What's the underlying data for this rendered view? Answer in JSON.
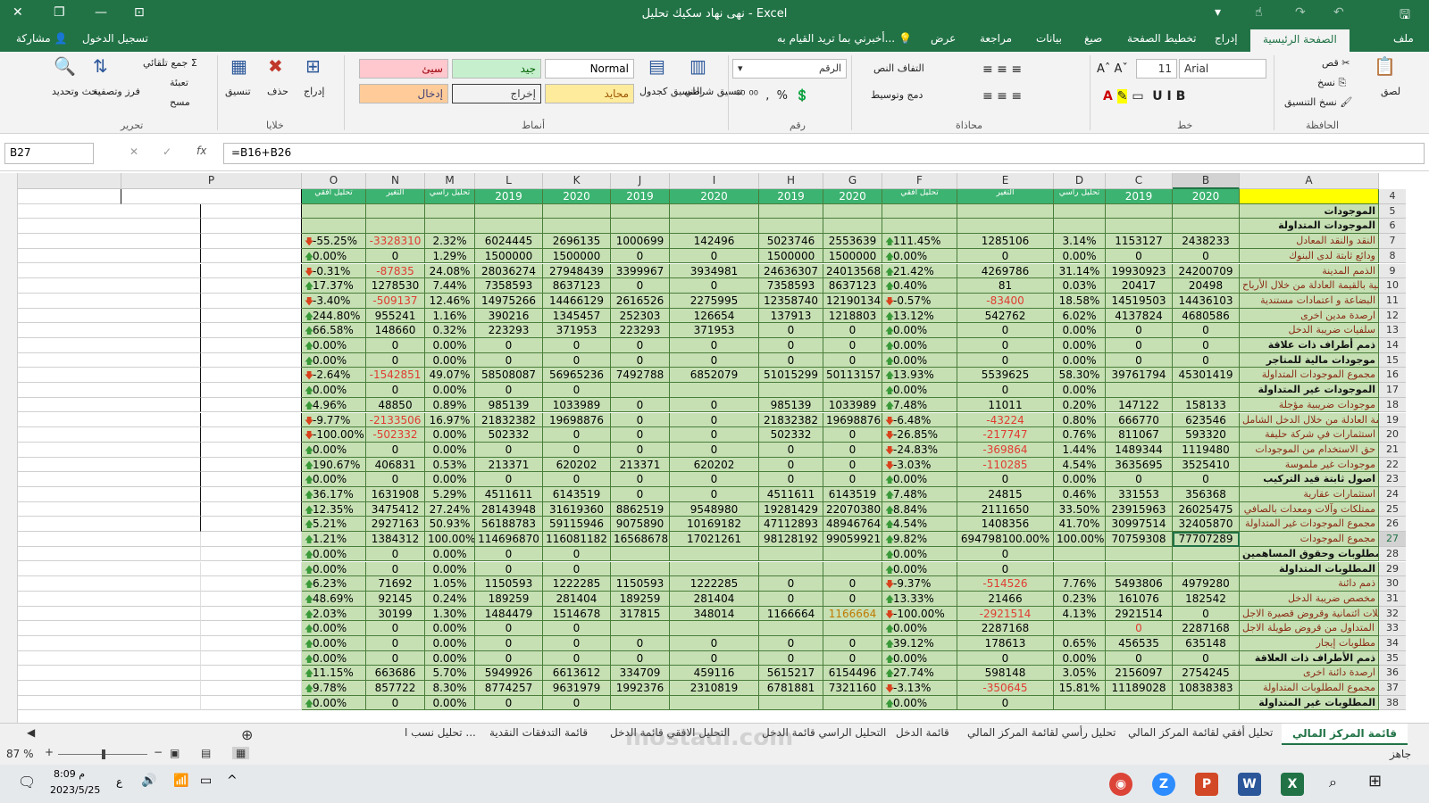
{
  "window": {
    "title": "نهى نهاد سكيك تحليل - Excel"
  },
  "ribbon_tabs": [
    "ملف",
    "الصفحة الرئيسية",
    "إدراج",
    "تخطيط الصفحة",
    "صيغ",
    "بيانات",
    "مراجعة",
    "عرض",
    "أخبرني بما تريد القيام به..."
  ],
  "share": "مشاركة",
  "signin": "تسجيل الدخول",
  "ribbon": {
    "paste": "لصق",
    "cut": "قص",
    "copy": "نسخ",
    "format_painter": "نسخ التنسيق",
    "clipboard": "الحافظة",
    "font_name": "Arial",
    "font_size": "11",
    "font_group": "خط",
    "wrap": "التفاف النص",
    "merge": "دمج وتوسيط",
    "align_group": "محاذاة",
    "number_format": "الرقم",
    "number_group": "رقم",
    "cond_format": "تنسيق شرطي",
    "format_table": "التنسيق كجدول",
    "styles_group": "أنماط",
    "style_normal": "Normal",
    "style_good": "جيد",
    "style_bad": "سيئ",
    "style_neutral": "محايد",
    "style_output": "إخراج",
    "style_input": "إدخال",
    "insert": "إدراج",
    "delete": "حذف",
    "format": "تنسيق",
    "cells_group": "خلايا",
    "autosum": "جمع تلقائي",
    "fill": "تعبئة",
    "clear": "مسح",
    "sort": "فرز وتصفية",
    "find": "بحث وتحديد",
    "edit_group": "تحرير"
  },
  "formula_bar": {
    "name_box": "B27",
    "formula": "=B16+B26"
  },
  "columns": [
    "A",
    "B",
    "C",
    "D",
    "E",
    "F",
    "G",
    "H",
    "I",
    "J",
    "K",
    "L",
    "M",
    "N",
    "O",
    "P"
  ],
  "header_row": {
    "row": "4",
    "B": "2020",
    "C": "2019",
    "D": "تحليل رأسي",
    "E": "التغير",
    "F": "تحليل أفقي",
    "G": "2020",
    "H": "2019",
    "I": "2020",
    "J": "2019",
    "K": "2020",
    "L": "2019",
    "M": "تحليل رأسي",
    "N": "التغير",
    "O": "تحليل أفقي"
  },
  "rows": [
    {
      "r": "5",
      "A": "الموجودات",
      "k": 1,
      "B": "",
      "C": "",
      "D": "",
      "E": "",
      "F": "",
      "Fa": "",
      "G": "",
      "H": "",
      "I": "",
      "J": "",
      "K": "",
      "L": "",
      "M": "",
      "N": "",
      "O": "",
      "Oa": ""
    },
    {
      "r": "6",
      "A": "الموجودات المتداولة",
      "k": 1,
      "B": "",
      "C": "",
      "D": "",
      "E": "",
      "F": "",
      "Fa": "",
      "G": "",
      "H": "",
      "I": "",
      "J": "",
      "K": "",
      "L": "",
      "M": "",
      "N": "",
      "O": "",
      "Oa": ""
    },
    {
      "r": "7",
      "A": "النقد والنقد المعادل",
      "B": "2438233",
      "C": "1153127",
      "D": "3.14%",
      "E": "1285106",
      "F": "111.45%",
      "Fa": "u",
      "G": "2553639",
      "H": "5023746",
      "I": "142496",
      "J": "1000699",
      "K": "2696135",
      "L": "6024445",
      "M": "2.32%",
      "N": "-3328310",
      "O": "-55.25%",
      "Oa": "d"
    },
    {
      "r": "8",
      "A": "ودائع ثابتة لدى البنوك",
      "B": "0",
      "C": "0",
      "D": "0.00%",
      "E": "0",
      "F": "0.00%",
      "Fa": "u",
      "G": "1500000",
      "H": "1500000",
      "I": "0",
      "J": "0",
      "K": "1500000",
      "L": "1500000",
      "M": "1.29%",
      "N": "0",
      "O": "0.00%",
      "Oa": "u"
    },
    {
      "r": "9",
      "A": "الذمم المدينة",
      "B": "24200709",
      "C": "19930923",
      "D": "31.14%",
      "E": "4269786",
      "F": "21.42%",
      "Fa": "u",
      "G": "24013568",
      "H": "24636307",
      "I": "3934981",
      "J": "3399967",
      "K": "27948439",
      "L": "28036274",
      "M": "24.08%",
      "N": "-87835",
      "O": "-0.31%",
      "Oa": "d"
    },
    {
      "r": "10",
      "A": "موجودات مالية بالقيمة العادلة من خلال الأرباح",
      "B": "20498",
      "C": "20417",
      "D": "0.03%",
      "E": "81",
      "F": "0.40%",
      "Fa": "u",
      "G": "8637123",
      "H": "7358593",
      "I": "0",
      "J": "0",
      "K": "8637123",
      "L": "7358593",
      "M": "7.44%",
      "N": "1278530",
      "O": "17.37%",
      "Oa": "u"
    },
    {
      "r": "11",
      "A": "البضاعة و اعتمادات مستندية",
      "B": "14436103",
      "C": "14519503",
      "D": "18.58%",
      "E": "-83400",
      "F": "-0.57%",
      "Fa": "d",
      "G": "12190134",
      "H": "12358740",
      "I": "2275995",
      "J": "2616526",
      "K": "14466129",
      "L": "14975266",
      "M": "12.46%",
      "N": "-509137",
      "O": "-3.40%",
      "Oa": "d"
    },
    {
      "r": "12",
      "A": "ارصدة مدين اخرى",
      "B": "4680586",
      "C": "4137824",
      "D": "6.02%",
      "E": "542762",
      "F": "13.12%",
      "Fa": "u",
      "G": "1218803",
      "H": "137913",
      "I": "126654",
      "J": "252303",
      "K": "1345457",
      "L": "390216",
      "M": "1.16%",
      "N": "955241",
      "O": "244.80%",
      "Oa": "u"
    },
    {
      "r": "13",
      "A": "سلفيات ضريبة الدخل",
      "B": "0",
      "C": "0",
      "D": "0.00%",
      "E": "0",
      "F": "0.00%",
      "Fa": "u",
      "G": "0",
      "H": "0",
      "I": "371953",
      "J": "223293",
      "K": "371953",
      "L": "223293",
      "M": "0.32%",
      "N": "148660",
      "O": "66.58%",
      "Oa": "u"
    },
    {
      "r": "14",
      "A": "ذمم أطراف ذات علاقة",
      "k": 1,
      "B": "0",
      "C": "0",
      "D": "0.00%",
      "E": "0",
      "F": "0.00%",
      "Fa": "u",
      "G": "0",
      "H": "0",
      "I": "0",
      "J": "0",
      "K": "0",
      "L": "0",
      "M": "0.00%",
      "N": "0",
      "O": "0.00%",
      "Oa": "u"
    },
    {
      "r": "15",
      "A": "موجودات مالية للمتاجر",
      "k": 1,
      "B": "0",
      "C": "0",
      "D": "0.00%",
      "E": "0",
      "F": "0.00%",
      "Fa": "u",
      "G": "0",
      "H": "0",
      "I": "0",
      "J": "0",
      "K": "0",
      "L": "0",
      "M": "0.00%",
      "N": "0",
      "O": "0.00%",
      "Oa": "u"
    },
    {
      "r": "16",
      "A": "مجموع الموجودات المتداولة",
      "B": "45301419",
      "C": "39761794",
      "D": "58.30%",
      "E": "5539625",
      "F": "13.93%",
      "Fa": "u",
      "G": "50113157",
      "H": "51015299",
      "I": "6852079",
      "J": "7492788",
      "K": "56965236",
      "L": "58508087",
      "M": "49.07%",
      "N": "-1542851",
      "O": "-2.64%",
      "Oa": "d"
    },
    {
      "r": "17",
      "A": "الموجودات غير المتداولة",
      "k": 1,
      "B": "",
      "C": "",
      "D": "0.00%",
      "E": "0",
      "F": "0.00%",
      "Fa": "u",
      "G": "",
      "H": "",
      "I": "",
      "J": "",
      "K": "0",
      "L": "0",
      "M": "0.00%",
      "N": "0",
      "O": "0.00%",
      "Oa": "u"
    },
    {
      "r": "18",
      "A": "موجودات ضريبية مؤجلة",
      "B": "158133",
      "C": "147122",
      "D": "0.20%",
      "E": "11011",
      "F": "7.48%",
      "Fa": "u",
      "G": "1033989",
      "H": "985139",
      "I": "0",
      "J": "0",
      "K": "1033989",
      "L": "985139",
      "M": "0.89%",
      "N": "48850",
      "O": "4.96%",
      "Oa": "u"
    },
    {
      "r": "19",
      "A": "موجودات مالية بالقيمة العادلة من خلال الدخل الشامل",
      "B": "623546",
      "C": "666770",
      "D": "0.80%",
      "E": "-43224",
      "F": "-6.48%",
      "Fa": "d",
      "G": "19698876",
      "H": "21832382",
      "I": "0",
      "J": "0",
      "K": "19698876",
      "L": "21832382",
      "M": "16.97%",
      "N": "-2133506",
      "O": "-9.77%",
      "Oa": "d"
    },
    {
      "r": "20",
      "A": "استثمارات في شركة حليفة",
      "B": "593320",
      "C": "811067",
      "D": "0.76%",
      "E": "-217747",
      "F": "-26.85%",
      "Fa": "d",
      "G": "0",
      "H": "502332",
      "I": "0",
      "J": "0",
      "K": "0",
      "L": "502332",
      "M": "0.00%",
      "N": "-502332",
      "O": "-100.00%",
      "Oa": "d"
    },
    {
      "r": "21",
      "A": "حق الاستخدام من الموجودات",
      "B": "1119480",
      "C": "1489344",
      "D": "1.44%",
      "E": "-369864",
      "F": "-24.83%",
      "Fa": "d",
      "G": "0",
      "H": "0",
      "I": "0",
      "J": "0",
      "K": "0",
      "L": "0",
      "M": "0.00%",
      "N": "0",
      "O": "0.00%",
      "Oa": "u"
    },
    {
      "r": "22",
      "A": "موجودات غير ملموسة",
      "B": "3525410",
      "C": "3635695",
      "D": "4.54%",
      "E": "-110285",
      "F": "-3.03%",
      "Fa": "d",
      "G": "0",
      "H": "0",
      "I": "620202",
      "J": "213371",
      "K": "620202",
      "L": "213371",
      "M": "0.53%",
      "N": "406831",
      "O": "190.67%",
      "Oa": "u"
    },
    {
      "r": "23",
      "A": "اصول ثابتة قيد التركيب",
      "k": 1,
      "B": "0",
      "C": "0",
      "D": "0.00%",
      "E": "0",
      "F": "0.00%",
      "Fa": "u",
      "G": "0",
      "H": "0",
      "I": "0",
      "J": "0",
      "K": "0",
      "L": "0",
      "M": "0.00%",
      "N": "0",
      "O": "0.00%",
      "Oa": "u"
    },
    {
      "r": "24",
      "A": "استثمارات عقارية",
      "B": "356368",
      "C": "331553",
      "D": "0.46%",
      "E": "24815",
      "F": "7.48%",
      "Fa": "u",
      "G": "6143519",
      "H": "4511611",
      "I": "0",
      "J": "0",
      "K": "6143519",
      "L": "4511611",
      "M": "5.29%",
      "N": "1631908",
      "O": "36.17%",
      "Oa": "u"
    },
    {
      "r": "25",
      "A": "ممتلكات وآلات ومعدات بالصافي",
      "B": "26025475",
      "C": "23915963",
      "D": "33.50%",
      "E": "2111650",
      "F": "8.84%",
      "Fa": "u",
      "G": "22070380",
      "H": "19281429",
      "I": "9548980",
      "J": "8862519",
      "K": "31619360",
      "L": "28143948",
      "M": "27.24%",
      "N": "3475412",
      "O": "12.35%",
      "Oa": "u"
    },
    {
      "r": "26",
      "A": "مجموع الموجودات غير المتداولة",
      "B": "32405870",
      "C": "30997514",
      "D": "41.70%",
      "E": "1408356",
      "F": "4.54%",
      "Fa": "u",
      "G": "48946764",
      "H": "47112893",
      "I": "10169182",
      "J": "9075890",
      "K": "59115946",
      "L": "56188783",
      "M": "50.93%",
      "N": "2927163",
      "O": "5.21%",
      "Oa": "u"
    },
    {
      "r": "27",
      "A": "مجموع الموجودات",
      "B": "77707289",
      "C": "70759308",
      "D": "100.00%",
      "E": "694798100.00%",
      "F": "9.82%",
      "Fa": "u",
      "G": "99059921",
      "H": "98128192",
      "I": "17021261",
      "J": "16568678",
      "K": "116081182",
      "L": "114696870",
      "M": "100.00%",
      "N": "1384312",
      "O": "1.21%",
      "Oa": "u"
    },
    {
      "r": "28",
      "A": "المطلوبات وحقوق المساهمين",
      "k": 1,
      "B": "",
      "C": "",
      "D": "",
      "E": "0",
      "F": "0.00%",
      "Fa": "u",
      "G": "",
      "H": "",
      "I": "",
      "J": "",
      "K": "0",
      "L": "0",
      "M": "0.00%",
      "N": "0",
      "O": "0.00%",
      "Oa": "u"
    },
    {
      "r": "29",
      "A": "المطلوبات المتداولة",
      "k": 1,
      "B": "",
      "C": "",
      "D": "",
      "E": "0",
      "F": "0.00%",
      "Fa": "u",
      "G": "",
      "H": "",
      "I": "",
      "J": "",
      "K": "0",
      "L": "0",
      "M": "0.00%",
      "N": "0",
      "O": "0.00%",
      "Oa": "u"
    },
    {
      "r": "30",
      "A": "ذمم دائنة",
      "B": "4979280",
      "C": "5493806",
      "D": "7.76%",
      "E": "-514526",
      "F": "-9.37%",
      "Fa": "d",
      "G": "0",
      "H": "0",
      "I": "1222285",
      "J": "1150593",
      "K": "1222285",
      "L": "1150593",
      "M": "1.05%",
      "N": "71692",
      "O": "6.23%",
      "Oa": "u"
    },
    {
      "r": "31",
      "A": "مخصص ضريبة الدخل",
      "B": "182542",
      "C": "161076",
      "D": "0.23%",
      "E": "21466",
      "F": "13.33%",
      "Fa": "u",
      "G": "0",
      "H": "0",
      "I": "281404",
      "J": "189259",
      "K": "281404",
      "L": "189259",
      "M": "0.24%",
      "N": "92145",
      "O": "48.69%",
      "Oa": "u"
    },
    {
      "r": "32",
      "A": "تسهيلات ائتمانية وقروض قصيرة الاجل",
      "B": "0",
      "C": "2921514",
      "D": "4.13%",
      "E": "-2921514",
      "F": "-100.00%",
      "Fa": "d",
      "G": "1166664",
      "H": "1166664",
      "I": "348014",
      "J": "317815",
      "K": "1514678",
      "L": "1484479",
      "M": "1.30%",
      "N": "30199",
      "O": "2.03%",
      "Oa": "u"
    },
    {
      "r": "33",
      "A": "جزء المتداول من قروض طويلة الاجل",
      "B": "2287168",
      "C": "0",
      "D": "",
      "E": "2287168",
      "F": "0.00%",
      "Fa": "u",
      "G": "",
      "H": "",
      "I": "",
      "J": "",
      "K": "0",
      "L": "0",
      "M": "0.00%",
      "N": "0",
      "O": "0.00%",
      "Oa": "u"
    },
    {
      "r": "34",
      "A": "مطلوبات إيجار",
      "B": "635148",
      "C": "456535",
      "D": "0.65%",
      "E": "178613",
      "F": "39.12%",
      "Fa": "u",
      "G": "0",
      "H": "0",
      "I": "0",
      "J": "0",
      "K": "0",
      "L": "0",
      "M": "0.00%",
      "N": "0",
      "O": "0.00%",
      "Oa": "u"
    },
    {
      "r": "35",
      "A": "ذمم الأطراف ذات العلاقة",
      "k": 1,
      "B": "0",
      "C": "0",
      "D": "0.00%",
      "E": "0",
      "F": "0.00%",
      "Fa": "u",
      "G": "0",
      "H": "0",
      "I": "0",
      "J": "0",
      "K": "0",
      "L": "0",
      "M": "0.00%",
      "N": "0",
      "O": "0.00%",
      "Oa": "u"
    },
    {
      "r": "36",
      "A": "ارصدة دائنة اخرى",
      "B": "2754245",
      "C": "2156097",
      "D": "3.05%",
      "E": "598148",
      "F": "27.74%",
      "Fa": "u",
      "G": "6154496",
      "H": "5615217",
      "I": "459116",
      "J": "334709",
      "K": "6613612",
      "L": "5949926",
      "M": "5.70%",
      "N": "663686",
      "O": "11.15%",
      "Oa": "u"
    },
    {
      "r": "37",
      "A": "مجموع المطلوبات المتداولة",
      "B": "10838383",
      "C": "11189028",
      "D": "15.81%",
      "E": "-350645",
      "F": "-3.13%",
      "Fa": "d",
      "G": "7321160",
      "H": "6781881",
      "I": "2310819",
      "J": "1992376",
      "K": "9631979",
      "L": "8774257",
      "M": "8.30%",
      "N": "857722",
      "O": "9.78%",
      "Oa": "u"
    },
    {
      "r": "38",
      "A": "المطلوبات غير المتداولة",
      "k": 1,
      "B": "",
      "C": "",
      "D": "",
      "E": "0",
      "F": "0.00%",
      "Fa": "u",
      "G": "",
      "H": "",
      "I": "",
      "J": "",
      "K": "0",
      "L": "0",
      "M": "0.00%",
      "N": "0",
      "O": "0.00%",
      "Oa": "u"
    }
  ],
  "sheets": [
    "قائمة المركز المالي",
    "تحليل أفقي لقائمة المركز المالي",
    "تحليل رأسي لقائمة المركز المالي",
    "قائمة الدخل",
    "التحليل الراسي قائمة الدخل",
    "التحليل الافقي قائمة الدخل",
    "قائمة التدفقات النقدية",
    "تحليل نسب ا ..."
  ],
  "status": {
    "ready": "جاهز",
    "zoom": "87 %"
  },
  "taskbar": {
    "time": "8:09 م",
    "date": "2023/5/25",
    "lang": "ع"
  },
  "watermark": "mostaql.com"
}
